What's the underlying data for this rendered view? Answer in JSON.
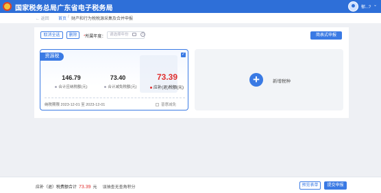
{
  "header": {
    "title": "国家税务总局广东省电子税务局",
    "user_name": "郁...?",
    "user_chevron": "⌄"
  },
  "breadcrumb": {
    "back": "← 返回",
    "home": "首页",
    "separator": "/",
    "current": "财产和行为税税源采集及合并申报"
  },
  "toolbar": {
    "cancel_select_label": "取消全选",
    "delete_label": "删除",
    "year_required_mark": "*",
    "year_label": "所属年度：",
    "year_placeholder": "请选择年份",
    "info_glyph": "i",
    "simple_declare_label": "简表式申报"
  },
  "tax_card": {
    "badge": "资源税",
    "checked": true,
    "payable_amount": "146.79",
    "payable_label": "合计应纳税额(元)",
    "reduction_amount": "73.40",
    "reduction_label": "合计减免税额(元)",
    "due_amount": "73.39",
    "due_label": "应补(退)税额(元)",
    "period": "纳税期限 2023-12-01 至 2023-12-01",
    "discount_label": "普惠减免"
  },
  "add_card": {
    "plus": "+",
    "label": "新增税种"
  },
  "footer": {
    "total_label": "应补（退）税费额合计",
    "total_amount": "73.39",
    "total_unit": "元",
    "total_note": "误抽查无查角积分",
    "preview_label": "预览表单",
    "submit_label": "提交申报"
  },
  "colors": {
    "brand": "#2e6fd8",
    "accent": "#3a7ae4",
    "due_red": "#e02d2d"
  }
}
